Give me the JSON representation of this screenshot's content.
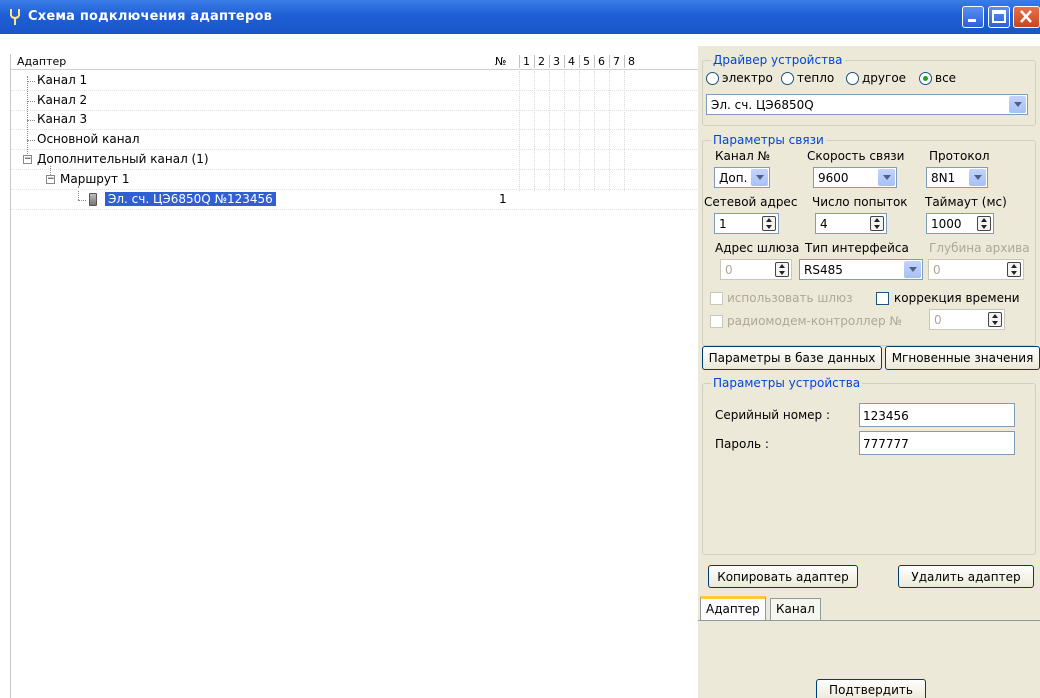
{
  "window": {
    "title": "Схема подключения адаптеров"
  },
  "tree": {
    "header_adapter": "Адаптер",
    "header_num": "№",
    "header_cols": [
      "1",
      "2",
      "3",
      "4",
      "5",
      "6",
      "7",
      "8"
    ],
    "rows": [
      {
        "label": "Канал 1"
      },
      {
        "label": "Канал 2"
      },
      {
        "label": "Канал 3"
      },
      {
        "label": "Основной канал"
      },
      {
        "label": "Дополнительный канал (1)"
      },
      {
        "label": "Маршрут 1"
      },
      {
        "label": "Эл. сч. ЦЭ6850Q №123456",
        "num": "1"
      }
    ]
  },
  "driver": {
    "legend": "Драйвер устройства",
    "radio_electro": "электро",
    "radio_heat": "тепло",
    "radio_other": "другое",
    "radio_all": "все",
    "selected": "Эл. сч. ЦЭ6850Q"
  },
  "link": {
    "legend": "Параметры связи",
    "channel_label": "Канал №",
    "channel_value": "Доп.",
    "speed_label": "Скорость связи",
    "speed_value": "9600",
    "protocol_label": "Протокол",
    "protocol_value": "8N1",
    "net_address_label": "Сетевой адрес",
    "net_address_value": "1",
    "attempts_label": "Число попыток",
    "attempts_value": "4",
    "timeout_label": "Таймаут (мс)",
    "timeout_value": "1000",
    "gateway_label": "Адрес шлюза",
    "gateway_value": "0",
    "interface_label": "Тип интерфейса",
    "interface_value": "RS485",
    "archive_label": "Глубина архива",
    "archive_value": "0",
    "use_gateway_label": "использовать шлюз",
    "time_correction_label": "коррекция времени",
    "radiomodem_label": "радиомодем-контроллер №",
    "radiomodem_value": "0"
  },
  "buttons": {
    "db_params": "Параметры в базе данных",
    "instant_values": "Мгновенные значения",
    "copy_adapter": "Копировать адаптер",
    "delete_adapter": "Удалить адаптер",
    "confirm": "Подтвердить"
  },
  "device": {
    "legend": "Параметры устройства",
    "serial_label": "Серийный номер :",
    "serial_value": "123456",
    "password_label": "Пароль :",
    "password_value": "777777"
  },
  "tabs": {
    "adapter": "Адаптер",
    "channel": "Канал"
  },
  "colors": {
    "titlebar": "#1f5fd6",
    "selection": "#2f5fd0",
    "legend_text": "#0046d5",
    "panel": "#ece9d8"
  }
}
